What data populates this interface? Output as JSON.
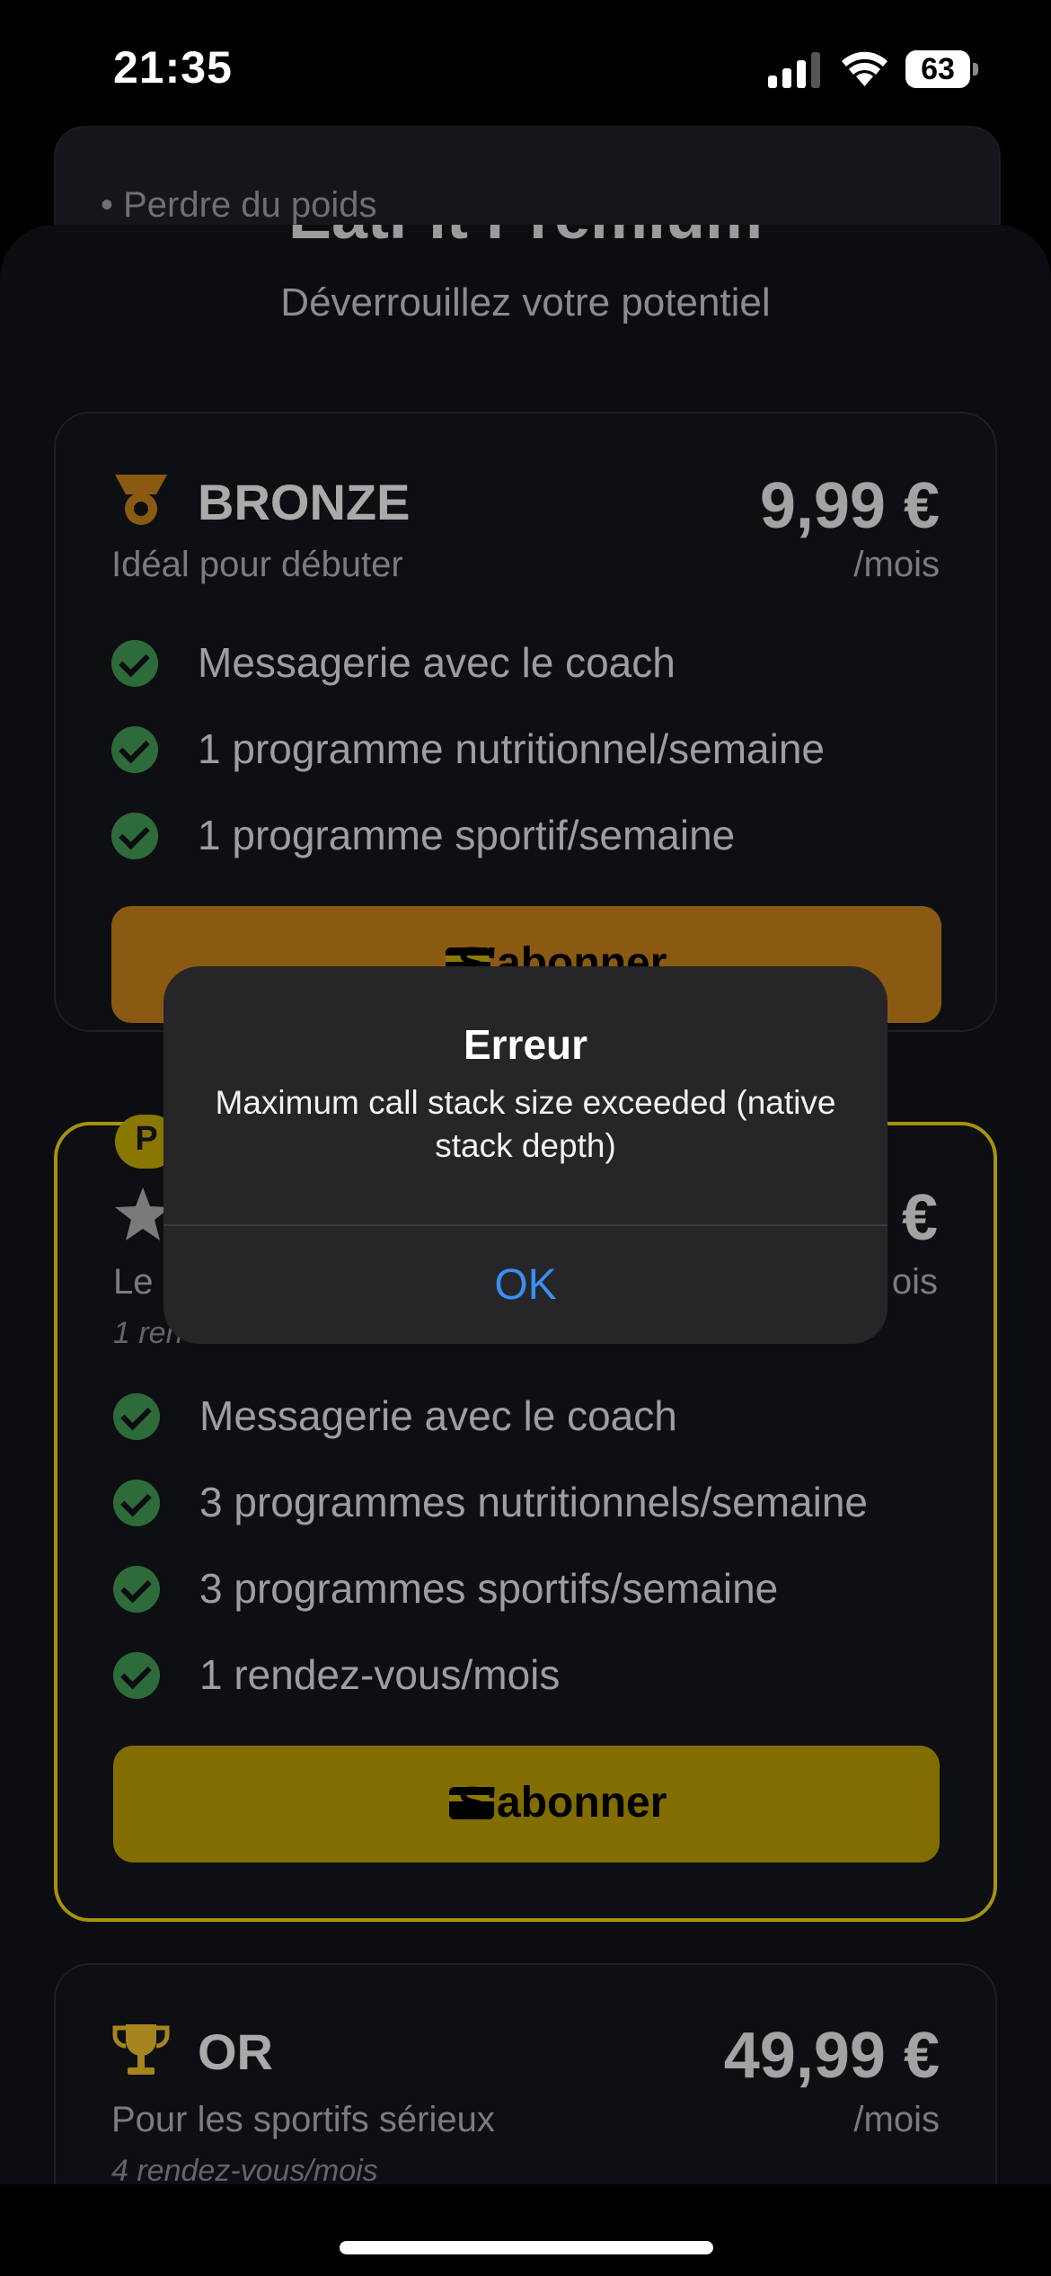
{
  "status_bar": {
    "time": "21:35",
    "battery": "63"
  },
  "background_card": {
    "item": "• Perdre du poids"
  },
  "sheet": {
    "title": "EatFit Premium",
    "subtitle": "Déverrouillez votre potentiel"
  },
  "plans": [
    {
      "name": "BRONZE",
      "desc": "Idéal pour débuter",
      "price": "9,99 €",
      "per": "/mois",
      "features": [
        "Messagerie avec le coach",
        "1 programme nutritionnel/semaine",
        "1 programme sportif/semaine"
      ],
      "button": "S'abonner",
      "accent": "#8a5a12"
    },
    {
      "badge": "P",
      "name_partial": "Le",
      "note_partial": "1 ren",
      "price": "€",
      "per": "ois",
      "features": [
        "Messagerie avec le coach",
        "3 programmes nutritionnels/semaine",
        "3 programmes sportifs/semaine",
        "1 rendez-vous/mois"
      ],
      "button": "S'abonner",
      "accent": "#826d00"
    },
    {
      "name": "OR",
      "desc": "Pour les sportifs sérieux",
      "note": "4 rendez-vous/mois",
      "price": "49,99 €",
      "per": "/mois",
      "accent": "#a6851f"
    }
  ],
  "alert": {
    "title": "Erreur",
    "message": "Maximum call stack size exceeded (native stack depth)",
    "ok": "OK"
  }
}
